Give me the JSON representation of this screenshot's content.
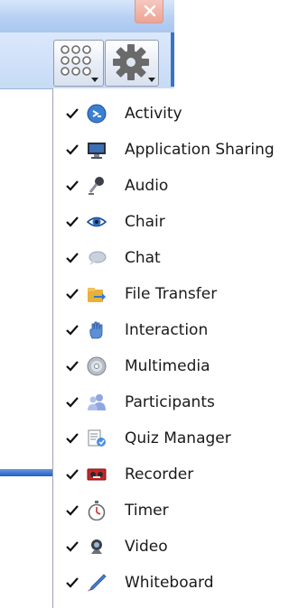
{
  "window": {
    "close_icon": "close-icon"
  },
  "toolbar": {
    "buttons": [
      {
        "name": "layout-grid-button",
        "icon": "grid-dots-icon",
        "has_dropdown": true
      },
      {
        "name": "settings-button",
        "icon": "gear-icon",
        "has_dropdown": true
      }
    ]
  },
  "menu": {
    "items": [
      {
        "label": "Activity",
        "checked": true,
        "icon": "activity-icon"
      },
      {
        "label": "Application Sharing",
        "checked": true,
        "icon": "monitor-icon"
      },
      {
        "label": "Audio",
        "checked": true,
        "icon": "microphone-icon"
      },
      {
        "label": "Chair",
        "checked": true,
        "icon": "eye-icon"
      },
      {
        "label": "Chat",
        "checked": true,
        "icon": "speech-bubble-icon"
      },
      {
        "label": "File Transfer",
        "checked": true,
        "icon": "file-transfer-icon"
      },
      {
        "label": "Interaction",
        "checked": true,
        "icon": "hand-icon"
      },
      {
        "label": "Multimedia",
        "checked": true,
        "icon": "disc-icon"
      },
      {
        "label": "Participants",
        "checked": true,
        "icon": "people-icon"
      },
      {
        "label": "Quiz Manager",
        "checked": true,
        "icon": "quiz-icon"
      },
      {
        "label": "Recorder",
        "checked": true,
        "icon": "recorder-icon"
      },
      {
        "label": "Timer",
        "checked": true,
        "icon": "stopwatch-icon"
      },
      {
        "label": "Video",
        "checked": true,
        "icon": "webcam-icon"
      },
      {
        "label": "Whiteboard",
        "checked": true,
        "icon": "pen-icon"
      }
    ]
  },
  "colors": {
    "titlebar": "#b7d0f3",
    "frame_blue": "#1d5fcf",
    "close_red": "#eea394"
  }
}
